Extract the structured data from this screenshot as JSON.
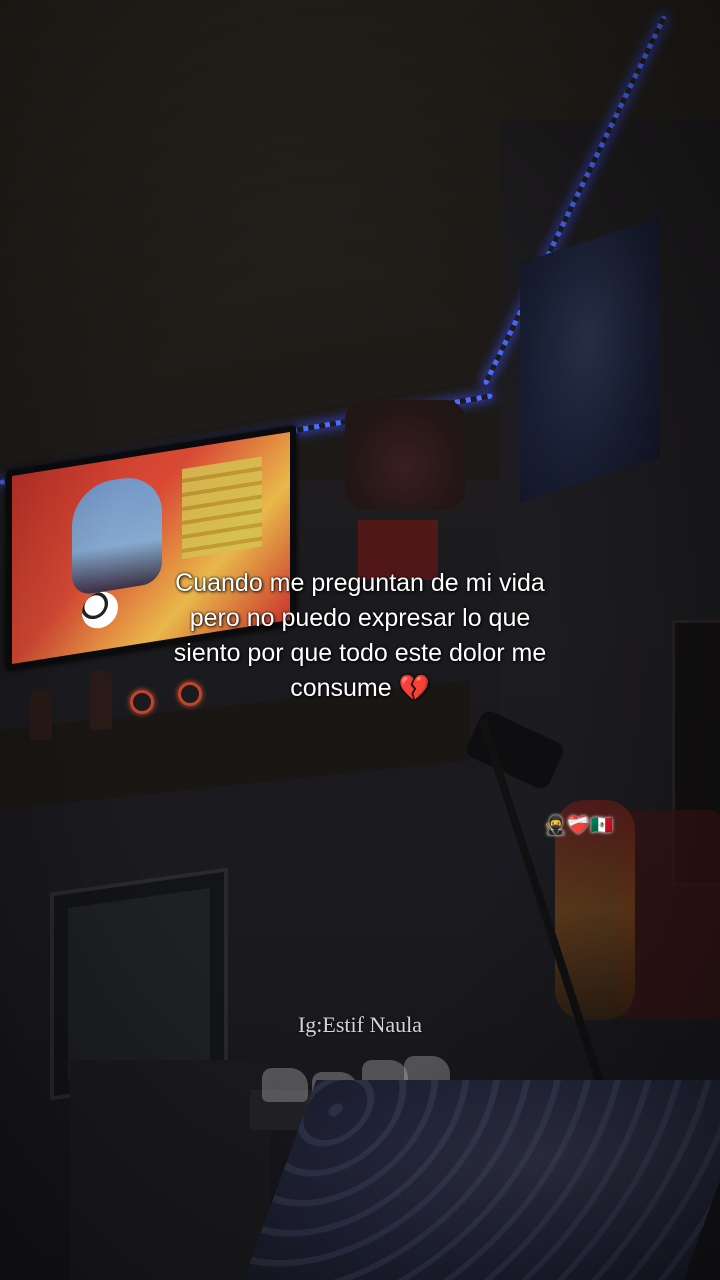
{
  "caption": {
    "lines": [
      "Cuando me preguntan de mi vida",
      "pero no puedo expresar lo que",
      "siento por que todo este dolor me",
      "consume"
    ],
    "emoji": "💔"
  },
  "sticker_emojis": "🥷❤️‍🩹🇲🇽",
  "credit": "Ig:Estif Naula",
  "led_color": "#4b6cff"
}
